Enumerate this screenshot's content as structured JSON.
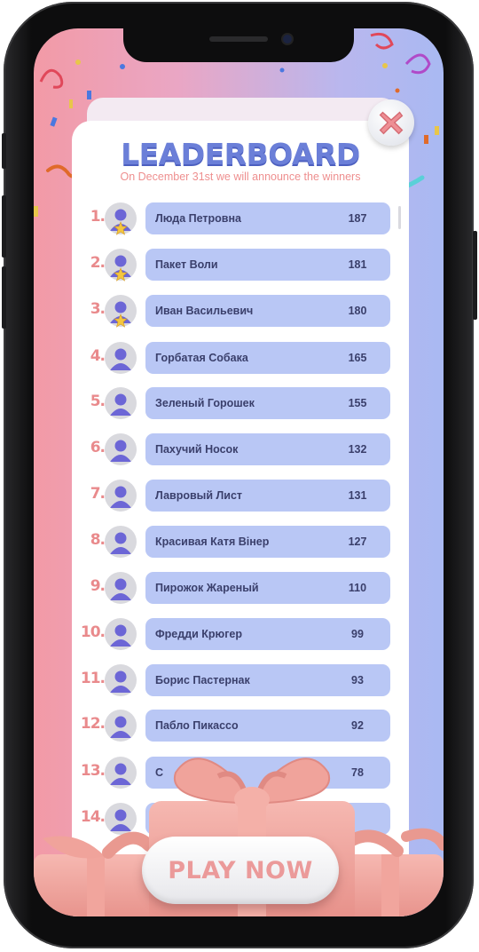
{
  "header": {
    "title": "LEADERBOARD",
    "subtitle": "On December 31st we will announce the winners"
  },
  "leaderboard": [
    {
      "rank": "1.",
      "name": "Люда Петровна",
      "score": "187",
      "star": true
    },
    {
      "rank": "2.",
      "name": "Пакет Воли",
      "score": "181",
      "star": true
    },
    {
      "rank": "3.",
      "name": "Иван Васильевич",
      "score": "180",
      "star": true
    },
    {
      "rank": "4.",
      "name": "Горбатая Собака",
      "score": "165",
      "star": false
    },
    {
      "rank": "5.",
      "name": "Зеленый Горошек",
      "score": "155",
      "star": false
    },
    {
      "rank": "6.",
      "name": "Пахучий Носок",
      "score": "132",
      "star": false
    },
    {
      "rank": "7.",
      "name": "Лавровый Лист",
      "score": "131",
      "star": false
    },
    {
      "rank": "8.",
      "name": "Красивая Катя Вінер",
      "score": "127",
      "star": false
    },
    {
      "rank": "9.",
      "name": "Пирожок Жареный",
      "score": "110",
      "star": false
    },
    {
      "rank": "10.",
      "name": "Фредди Крюгер",
      "score": "99",
      "star": false
    },
    {
      "rank": "11.",
      "name": "Борис Пастернак",
      "score": "93",
      "star": false
    },
    {
      "rank": "12.",
      "name": "Пабло Пикассо",
      "score": "92",
      "star": false
    },
    {
      "rank": "13.",
      "name": "С",
      "score": "78",
      "star": false
    },
    {
      "rank": "14.",
      "name": "",
      "score": "",
      "star": false
    }
  ],
  "play_button": {
    "label": "PLAY NOW"
  },
  "close_button": {
    "icon": "close-icon"
  },
  "colors": {
    "accent": "#6b7fd8",
    "rank": "#e98a8c",
    "row_bg": "#b9c7f5",
    "gift": "#f2a9a3"
  }
}
